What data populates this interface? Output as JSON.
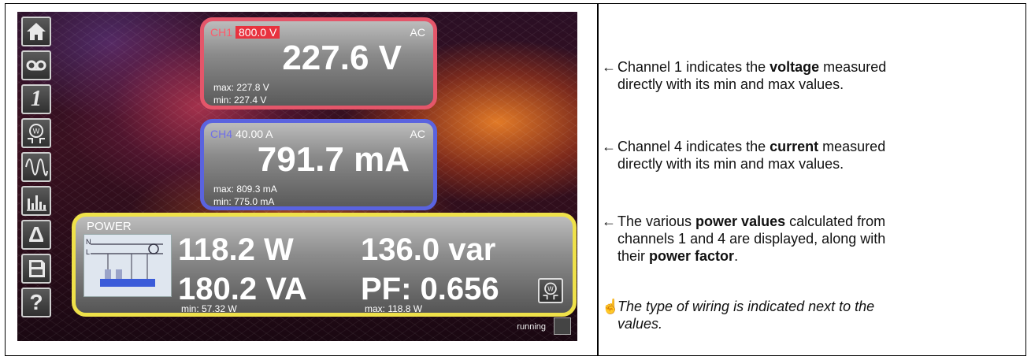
{
  "screen": {
    "toolbar": [
      "home-icon",
      "recording-icon",
      "channel-1-icon",
      "wiring-icon",
      "waveform-icon",
      "harmonics-icon",
      "delta-icon",
      "memory-card-icon",
      "help-icon"
    ],
    "toolbar_labels": {
      "one": "1",
      "delta": "Δ",
      "help": "?"
    },
    "ch1": {
      "name": "CH1",
      "range": "800.0 V",
      "mode": "AC",
      "value": "227.6 V",
      "max": "max: 227.8 V",
      "min": "min: 227.4 V",
      "color": "#e4566a"
    },
    "ch4": {
      "name": "CH4",
      "range": "40.00 A",
      "mode": "AC",
      "value": "791.7 mA",
      "max": "max: 809.3 mA",
      "min": "min: 775.0 mA",
      "color": "#5a63df"
    },
    "power": {
      "title": "POWER",
      "active": "118.2 W",
      "reactive": "136.0 var",
      "apparent": "180.2 VA",
      "pf": "PF: 0.656",
      "min": "min: 57.32 W",
      "max": "max: 118.8 W",
      "wiring_labels": {
        "n": "N",
        "l": "L"
      },
      "color": "#efe14a"
    },
    "status": "running"
  },
  "notes": {
    "n1": {
      "arrow": "←",
      "pre": "Channel 1 indicates the ",
      "bold": "voltage",
      "post": " measured",
      "line2": "directly with its min and max values."
    },
    "n2": {
      "arrow": "←",
      "pre": "Channel 4 indicates the ",
      "bold": "current",
      "post": " measured",
      "line2": "directly with its min and max values."
    },
    "n3": {
      "arrow": "←",
      "pre": "The various ",
      "bold": "power values",
      "post": " calculated from",
      "line2": "channels 1 and 4 are displayed, along with",
      "line3_pre": "their ",
      "line3_bold": "power factor",
      "line3_post": "."
    },
    "n4": {
      "hand": "☝",
      "line1": "The type of wiring is indicated next to the",
      "line2": "values."
    }
  }
}
